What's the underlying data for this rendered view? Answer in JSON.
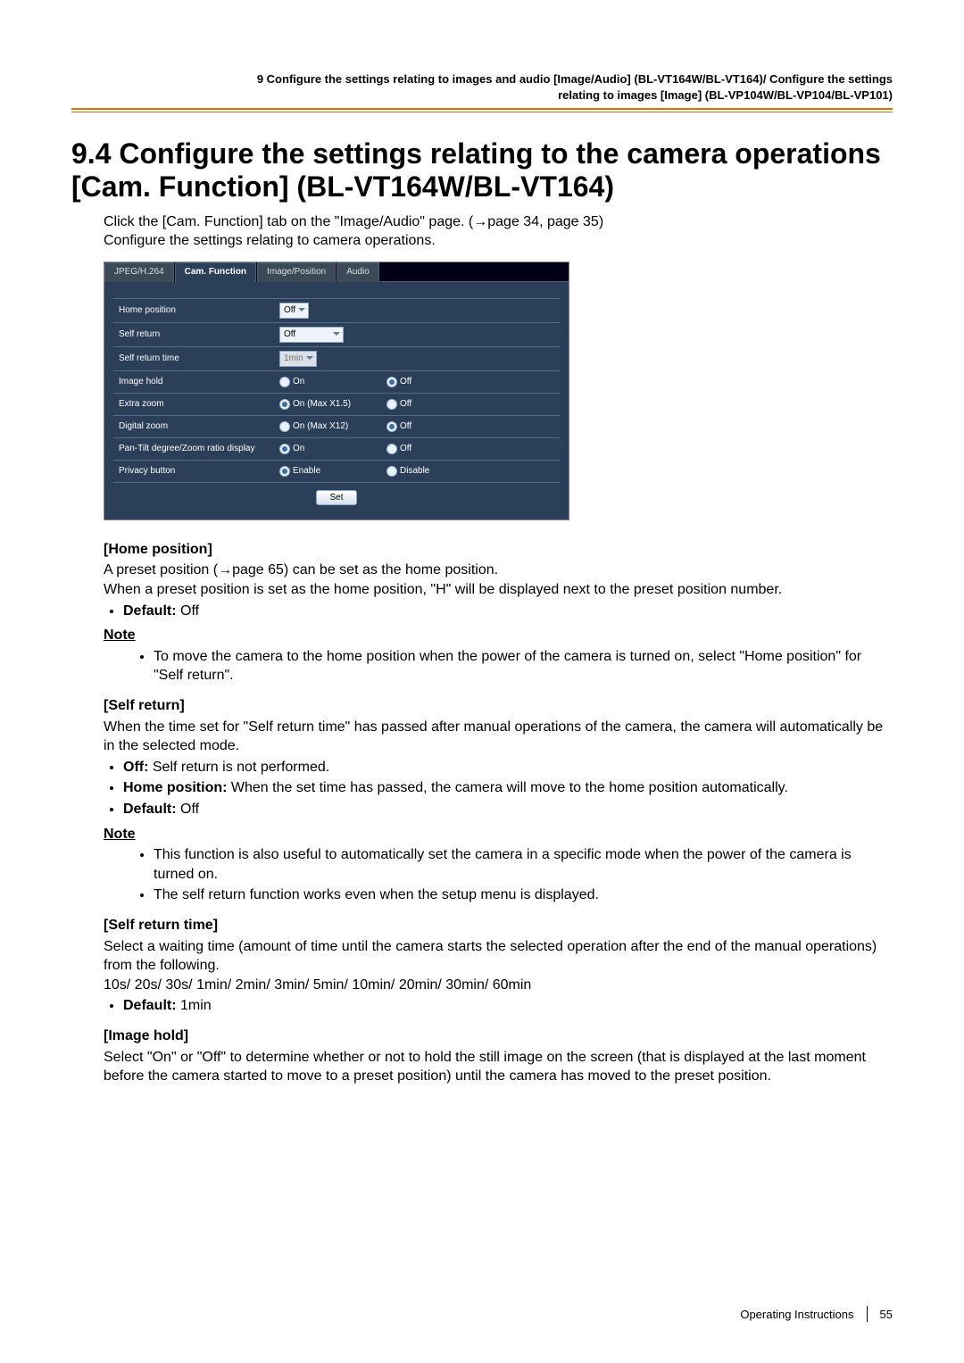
{
  "header": {
    "line1": "9 Configure the settings relating to images and audio [Image/Audio] (BL-VT164W/BL-VT164)/ Configure the settings",
    "line2": "relating to images [Image] (BL-VP104W/BL-VP104/BL-VP101)"
  },
  "title": "9.4  Configure the settings relating to the camera operations [Cam. Function] (BL-VT164W/BL-VT164)",
  "intro": {
    "l1a": "Click the [Cam. Function] tab on the \"Image/Audio\" page. (",
    "l1b": "page 34, page 35)",
    "l2": "Configure the settings relating to camera operations."
  },
  "ui": {
    "tabs": [
      "JPEG/H.264",
      "Cam. Function",
      "Image/Position",
      "Audio"
    ],
    "rows": {
      "home_position": {
        "label": "Home position",
        "value": "Off"
      },
      "self_return": {
        "label": "Self return",
        "value": "Off"
      },
      "self_return_time": {
        "label": "Self return time",
        "value": "1min"
      },
      "image_hold": {
        "label": "Image hold",
        "opt1": "On",
        "opt2": "Off"
      },
      "extra_zoom": {
        "label": "Extra zoom",
        "opt1": "On (Max X1.5)",
        "opt2": "Off"
      },
      "digital_zoom": {
        "label": "Digital zoom",
        "opt1": "On (Max X12)",
        "opt2": "Off"
      },
      "pantilt": {
        "label": "Pan-Tilt degree/Zoom ratio display",
        "opt1": "On",
        "opt2": "Off"
      },
      "privacy": {
        "label": "Privacy button",
        "opt1": "Enable",
        "opt2": "Disable"
      }
    },
    "set": "Set"
  },
  "sections": {
    "home_position": {
      "h": "[Home position]",
      "p1a": "A preset position (",
      "p1b": "page 65) can be set as the home position.",
      "p2": "When a preset position is set as the home position, \"H\" will be displayed next to the preset position number.",
      "def_label": "Default:",
      "def_val": " Off",
      "note": "Note",
      "note1": "To move the camera to the home position when the power of the camera is turned on, select \"Home position\" for \"Self return\"."
    },
    "self_return": {
      "h": "[Self return]",
      "p1": "When the time set for \"Self return time\" has passed after manual operations of the camera, the camera will automatically be in the selected mode.",
      "li1_label": "Off:",
      "li1_text": " Self return is not performed.",
      "li2_label": "Home position:",
      "li2_text": " When the set time has passed, the camera will move to the home position automatically.",
      "def_label": "Default:",
      "def_val": " Off",
      "note": "Note",
      "note1": "This function is also useful to automatically set the camera in a specific mode when the power of the camera is turned on.",
      "note2": "The self return function works even when the setup menu is displayed."
    },
    "self_return_time": {
      "h": "[Self return time]",
      "p1": "Select a waiting time (amount of time until the camera starts the selected operation after the end of the manual operations) from the following.",
      "p2": "10s/ 20s/ 30s/ 1min/ 2min/ 3min/ 5min/ 10min/ 20min/ 30min/ 60min",
      "def_label": "Default:",
      "def_val": " 1min"
    },
    "image_hold": {
      "h": "[Image hold]",
      "p1": "Select \"On\" or \"Off\" to determine whether or not to hold the still image on the screen (that is displayed at the last moment before the camera started to move to a preset position) until the camera has moved to the preset position."
    }
  },
  "footer": {
    "label": "Operating Instructions",
    "page": "55"
  }
}
